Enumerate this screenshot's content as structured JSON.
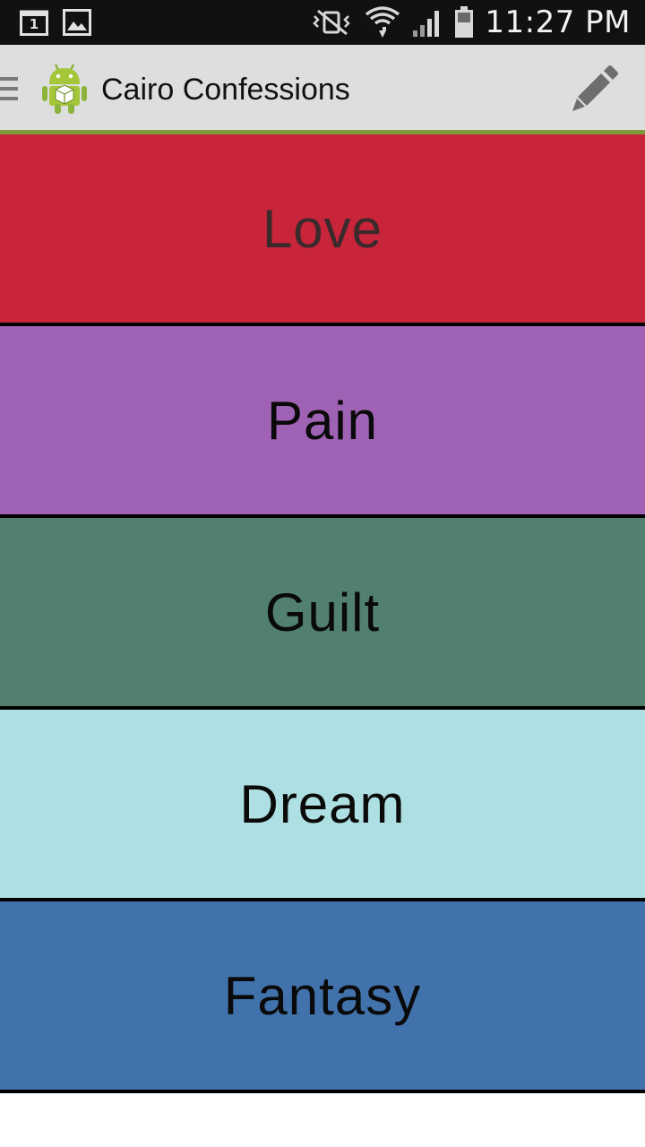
{
  "status_bar": {
    "time": "11:27 PM",
    "calendar_day": "1"
  },
  "action_bar": {
    "title": "Cairo Confessions",
    "accent_color": "#7f9a3c"
  },
  "categories": [
    {
      "label": "Love",
      "color": "#c8243a",
      "text_color": "#3a2a2c"
    },
    {
      "label": "Pain",
      "color": "#a062b4",
      "text_color": "#0a0a0a"
    },
    {
      "label": "Guilt",
      "color": "#52806e",
      "text_color": "#0a0a0a"
    },
    {
      "label": "Dream",
      "color": "#aedfe2",
      "text_color": "#0a0a0a"
    },
    {
      "label": "Fantasy",
      "color": "#4272ac",
      "text_color": "#0a0a0a"
    }
  ]
}
